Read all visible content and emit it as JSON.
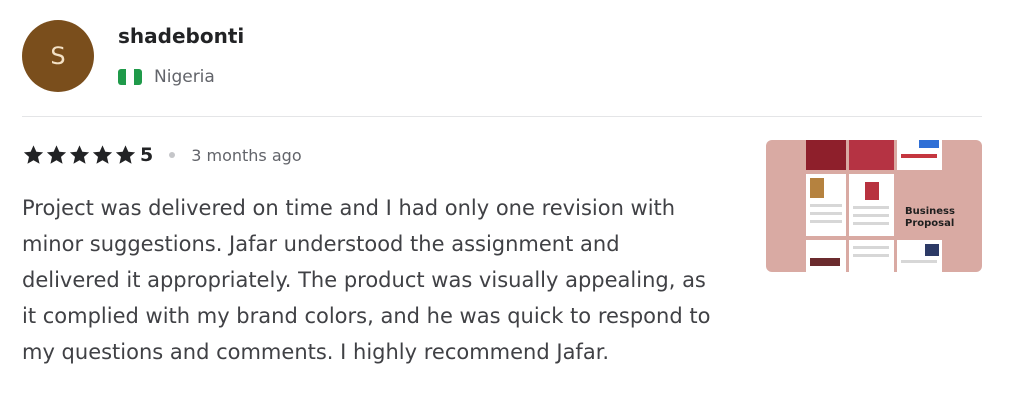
{
  "reviewer": {
    "avatar_initial": "S",
    "username": "shadebonti",
    "country": "Nigeria",
    "flag_icon": "nigeria-flag-icon"
  },
  "review": {
    "stars": 5,
    "rating_value": "5",
    "time_ago": "3 months ago",
    "text": "Project was delivered on time and I had only one revision with minor suggestions. Jafar understood the assignment and delivered it appropriately. The product was visually appealing, as it complied with my brand colors, and he was quick to respond to my questions and comments. I highly recommend Jafar."
  },
  "attachment": {
    "title_line1": "Business",
    "title_line2": "Proposal"
  },
  "colors": {
    "avatar_bg": "#7a4e1c",
    "star": "#222325",
    "thumb_bg": "#d9aaa3"
  }
}
